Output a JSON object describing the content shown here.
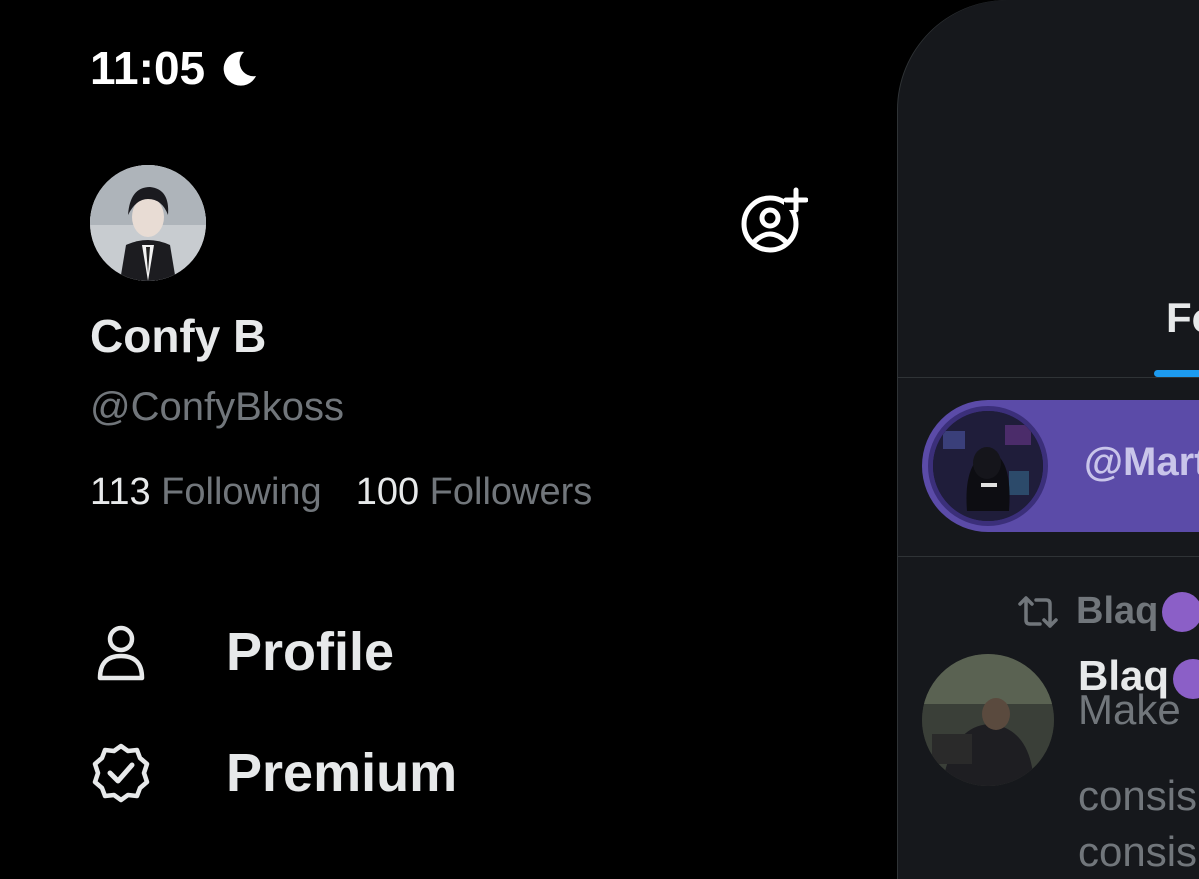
{
  "status_bar": {
    "time": "11:05",
    "icons": [
      "moon-icon",
      "cellular-signal-icon",
      "wifi-icon",
      "battery-charging-icon"
    ],
    "battery_color": "#4cd964"
  },
  "drawer": {
    "display_name": "Confy B",
    "handle": "@ConfyBkoss",
    "following_count": "113",
    "following_label": "Following",
    "followers_count": "100",
    "followers_label": "Followers",
    "nav": [
      {
        "label": "Profile",
        "icon": "person-icon"
      },
      {
        "label": "Premium",
        "icon": "verified-badge-icon"
      }
    ]
  },
  "timeline": {
    "tab_label": "Fo",
    "space_handle": "@Mart",
    "retweet_label": "Blaq",
    "tweet_author": "Blaq",
    "tweet_lines": [
      "Make",
      "consis",
      "consis"
    ],
    "accent_color": "#1d9bf0",
    "space_color": "#5b4ba8"
  }
}
